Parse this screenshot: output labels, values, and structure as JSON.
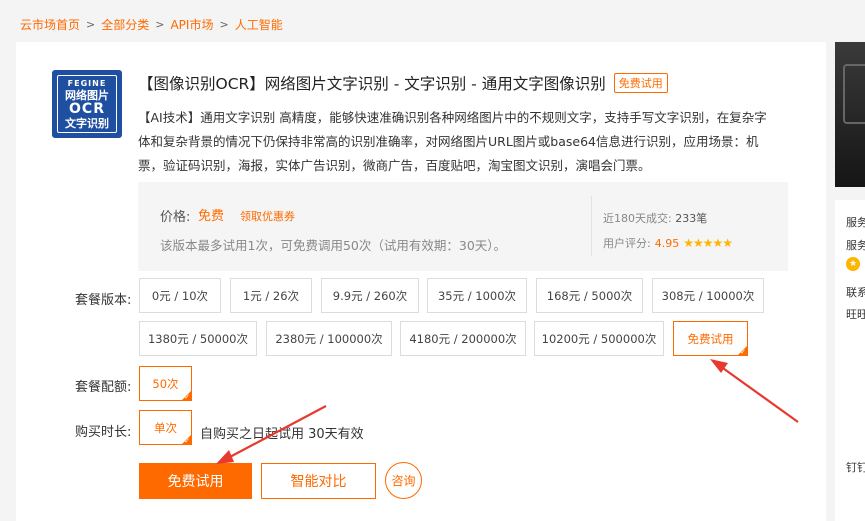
{
  "breadcrumb": {
    "items": [
      "云市场首页",
      "全部分类",
      "API市场",
      "人工智能"
    ],
    "separator": ">"
  },
  "logo": {
    "line1": "FEGINE",
    "line2": "网络图片",
    "line3": "OCR",
    "line4": "文字识别"
  },
  "product": {
    "title": "【图像识别OCR】网络图片文字识别 - 文字识别 - 通用文字图像识别",
    "tag": "免费试用",
    "description": "【AI技术】通用文字识别 高精度，能够快速准确识别各种网络图片中的不规则文字，支持手写文字识别，在复杂字体和复杂背景的情况下仍保持非常高的识别准确率，对网络图片URL图片或base64信息进行识别，应用场景：机票，验证码识别，海报，实体广告识别，微商广告，百度贴吧，淘宝图文识别，演唱会门票。"
  },
  "price": {
    "label": "价格:",
    "value": "免费",
    "coupon": "领取优惠券",
    "note": "该版本最多试用1次，可免费调用50次（试用有效期：30天）。",
    "deals_label": "近180天成交:",
    "deals_value": "233笔",
    "rating_label": "用户评分:",
    "rating_value": "4.95",
    "stars": "★★★★★"
  },
  "package": {
    "label": "套餐版本:",
    "options": [
      "0元 / 10次",
      "1元 / 26次",
      "9.9元 / 260次",
      "35元 / 1000次",
      "168元 / 5000次",
      "308元 / 10000次",
      "1380元 / 50000次",
      "2380元 / 100000次",
      "4180元 / 200000次",
      "10200元 / 500000次",
      "免费试用"
    ],
    "selected_index": 10
  },
  "config": {
    "label": "套餐配额:",
    "option": "50次"
  },
  "duration": {
    "label": "购买时长:",
    "option": "单次",
    "note": "自购买之日起试用 30天有效"
  },
  "actions": {
    "primary": "免费试用",
    "compare": "智能对比",
    "consult": "咨询"
  },
  "side": {
    "t1": "服务",
    "t2": "服务",
    "t3": "联系",
    "t4": "旺旺",
    "t5": "钉钉"
  },
  "colors": {
    "accent": "#ff6a00",
    "arrow": "#e8392f",
    "logo_blue": "#1e4fa0"
  }
}
